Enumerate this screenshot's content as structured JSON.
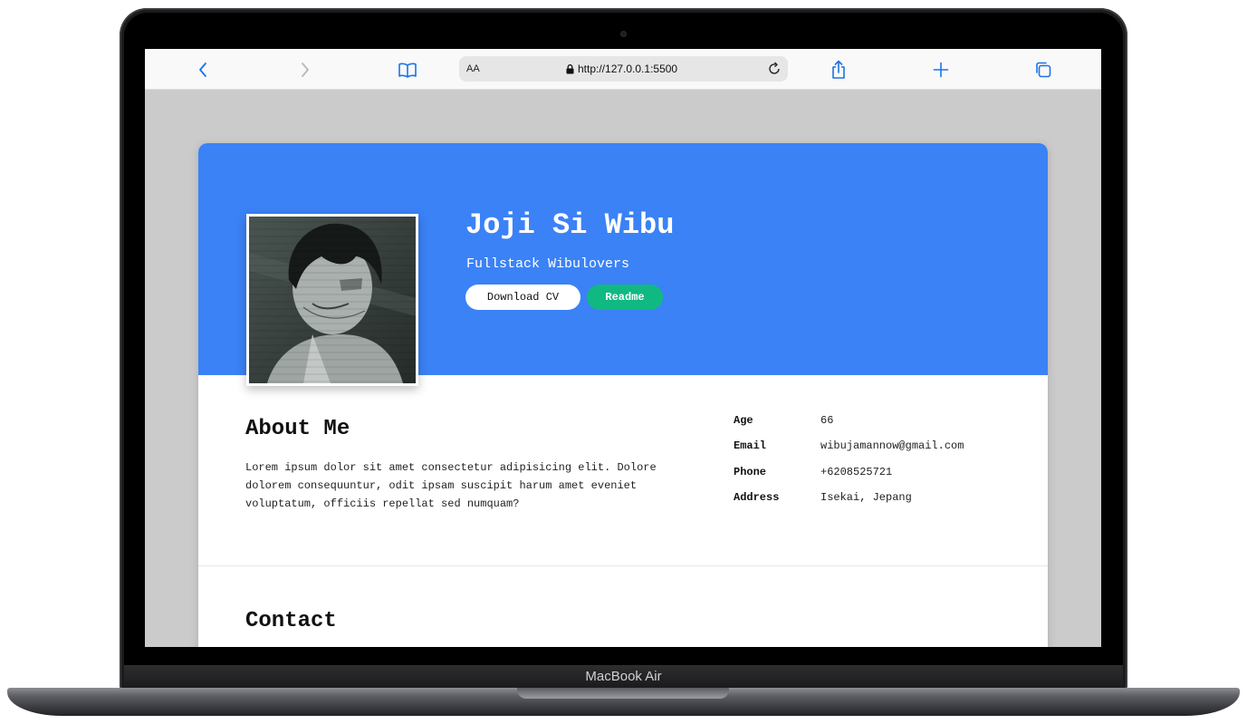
{
  "device": {
    "label": "MacBook Air"
  },
  "browser": {
    "address_prefix": "AA",
    "url": "http://127.0.0.1:5500",
    "icons": {
      "back": "chevron-left-icon",
      "forward": "chevron-right-icon",
      "bookmarks": "book-icon",
      "lock": "lock-icon",
      "reload": "reload-icon",
      "share": "share-icon",
      "new_tab": "plus-icon",
      "tabs": "tabs-icon"
    },
    "accent": "#1a73e8"
  },
  "profile": {
    "name": "Joji Si Wibu",
    "role": "Fullstack Wibulovers",
    "buttons": {
      "download": "Download CV",
      "readme": "Readme"
    },
    "colors": {
      "hero": "#3b82f6",
      "readme": "#10b981"
    }
  },
  "about": {
    "title": "About Me",
    "text": "Lorem ipsum dolor sit amet consectetur adipisicing elit. Dolore dolorem consequuntur, odit ipsam suscipit harum amet eveniet voluptatum, officiis repellat sed numquam?"
  },
  "info": [
    {
      "label": "Age",
      "value": "66"
    },
    {
      "label": "Email",
      "value": "wibujamannow@gmail.com"
    },
    {
      "label": "Phone",
      "value": "+6208525721"
    },
    {
      "label": "Address",
      "value": "Isekai, Jepang"
    }
  ],
  "contact": {
    "title": "Contact"
  }
}
